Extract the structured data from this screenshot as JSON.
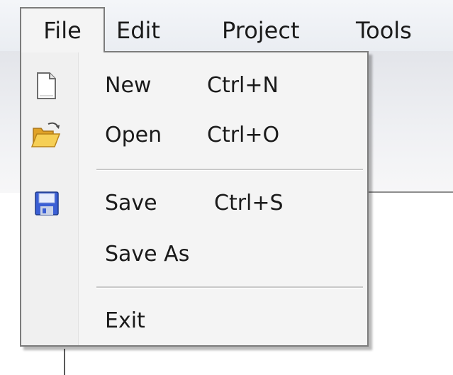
{
  "menubar": {
    "items": [
      {
        "label": "File"
      },
      {
        "label": "Edit"
      },
      {
        "label": "Project"
      },
      {
        "label": "Tools"
      }
    ]
  },
  "file_menu": {
    "items": [
      {
        "label": "New",
        "shortcut": "Ctrl+N",
        "icon": "new-document-icon"
      },
      {
        "label": "Open",
        "shortcut": "Ctrl+O",
        "icon": "open-folder-icon"
      },
      {
        "label": "Save",
        "shortcut": "Ctrl+S",
        "icon": "save-floppy-icon"
      },
      {
        "label": "Save As",
        "shortcut": ""
      },
      {
        "label": "Exit",
        "shortcut": ""
      }
    ]
  },
  "colors": {
    "menu_bg": "#f4f4f4",
    "menu_border": "#7c7c7c",
    "floppy_blue": "#3b5fd4",
    "folder_yellow": "#f2c13a"
  }
}
